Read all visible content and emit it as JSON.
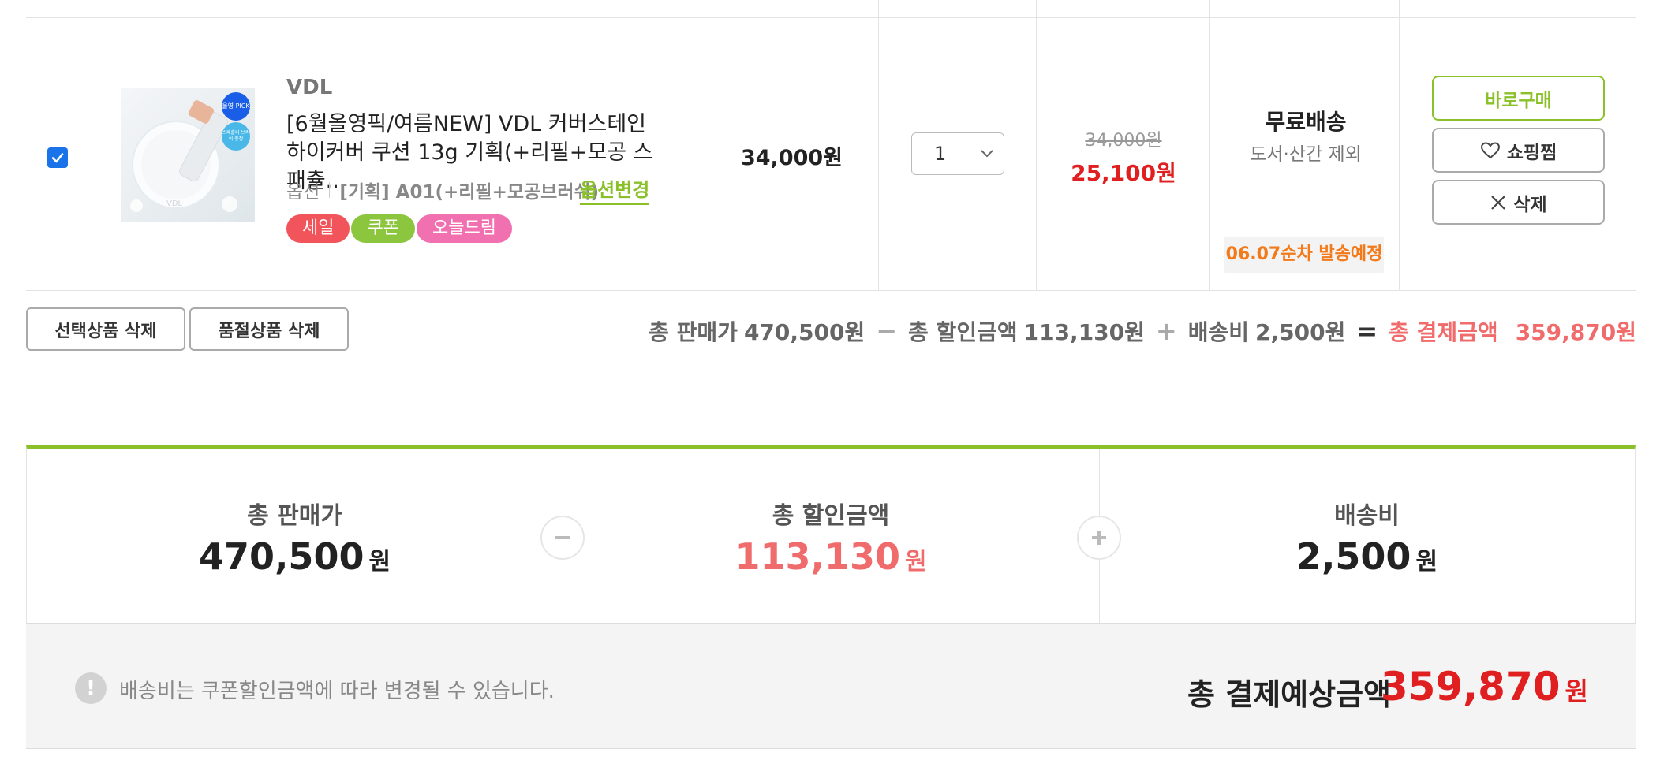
{
  "item": {
    "checked": true,
    "brand": "VDL",
    "name": "[6월올영픽/여름NEW] VDL 커버스테인 하이커버 쿠션 13g 기획(+리필+모공 스패츌...",
    "option_label": "옵션",
    "option_value": "[기획] A01(+리필+모공브러쉬)",
    "option_change": "옵션변경",
    "tags": [
      {
        "label": "세일",
        "color": "#f2545b"
      },
      {
        "label": "쿠폰",
        "color": "#8cc63f"
      },
      {
        "label": "오늘드림",
        "color": "#f070b0"
      }
    ],
    "thumbnail_badges": {
      "top": "올영 PICK",
      "bottom": "스패츌러 브러쉬 증정"
    },
    "unit_price": "34,000원",
    "quantity": "1",
    "original_price": "34,000원",
    "sale_price": "25,100원",
    "shipping_title": "무료배송",
    "shipping_note": "도서·산간 제외",
    "ship_date": "06.07순차 발송예정",
    "buttons": {
      "buy": "바로구매",
      "wish": "쇼핑찜",
      "delete": "삭제"
    }
  },
  "actions": {
    "delete_selected": "선택상품 삭제",
    "delete_soldout": "품절상품 삭제"
  },
  "summary_line": {
    "total_label": "총 판매가",
    "total_value": "470,500원",
    "discount_label": "총 할인금액",
    "discount_value": "113,130원",
    "shipping_label": "배송비",
    "shipping_value": "2,500원",
    "final_label": "총 결제금액",
    "final_value": "359,870원"
  },
  "panel": {
    "total_label": "총 판매가",
    "total_value": "470,500",
    "discount_label": "총 할인금액",
    "discount_value": "113,130",
    "shipping_label": "배송비",
    "shipping_value": "2,500",
    "won": "원"
  },
  "footer": {
    "notice": "배송비는 쿠폰할인금액에 따라 변경될 수 있습니다.",
    "grand_label": "총 결제예상금액",
    "grand_value": "359,870",
    "won": "원"
  },
  "colors": {
    "accent_green": "#8ac028",
    "price_red": "#e02020",
    "summary_pink": "#f06b6b",
    "ship_orange": "#f27a1a"
  }
}
